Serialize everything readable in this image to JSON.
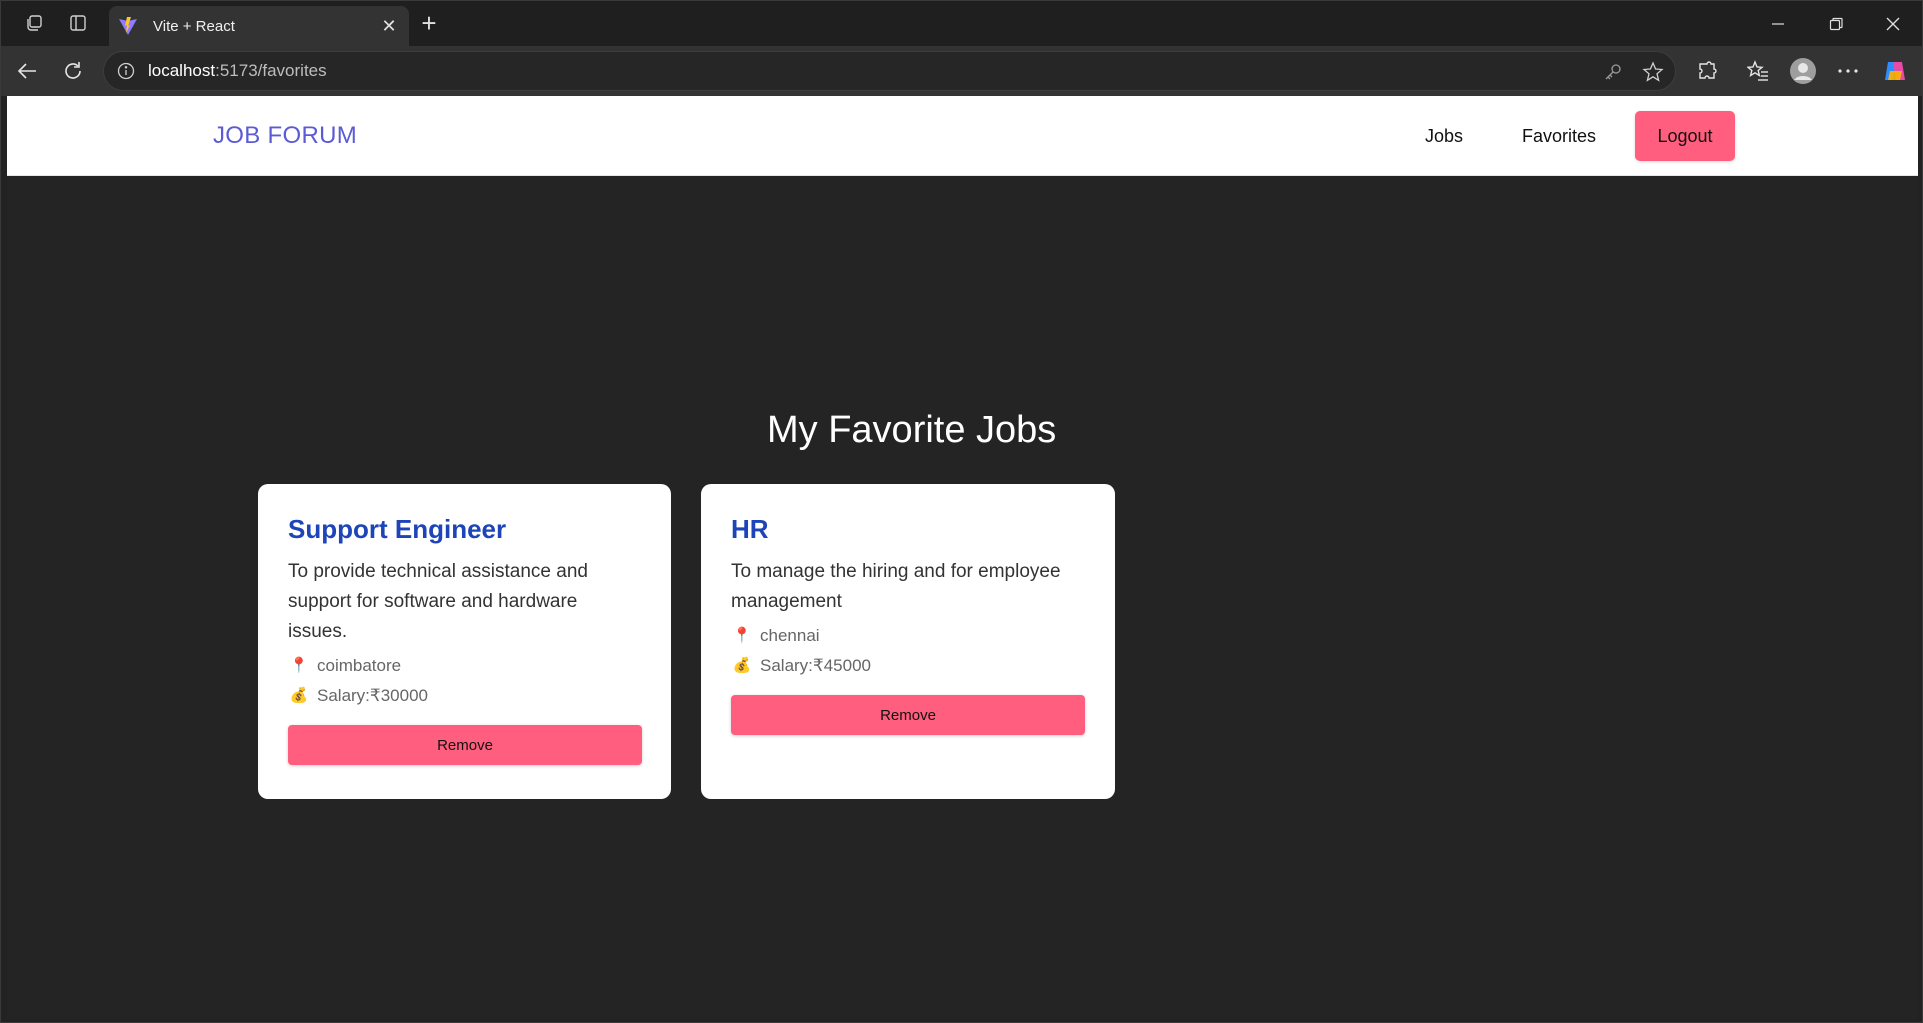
{
  "browser": {
    "tab_title": "Vite + React",
    "url_host": "localhost",
    "url_path": ":5173/favorites",
    "newtab_label": "+",
    "tab_close_label": "✕"
  },
  "navbar": {
    "brand": "JOB FORUM",
    "links": [
      "Jobs",
      "Favorites"
    ],
    "logout_label": "Logout"
  },
  "page": {
    "title": "My Favorite Jobs"
  },
  "jobs": [
    {
      "title": "Support Engineer",
      "description": "To provide technical assistance and support for software and hardware issues.",
      "location": "coimbatore",
      "salary": "Salary:₹30000",
      "button": "Remove"
    },
    {
      "title": "HR",
      "description": "To manage the hiring and for employee management",
      "location": "chennai",
      "salary": "Salary:₹45000",
      "button": "Remove"
    }
  ],
  "icons": {
    "location": "📍",
    "salary": "💰"
  },
  "colors": {
    "brand": "#5b5bd6",
    "accent_button": "#ff5e7e",
    "job_title": "#1d44b8",
    "page_bg": "#242424"
  }
}
